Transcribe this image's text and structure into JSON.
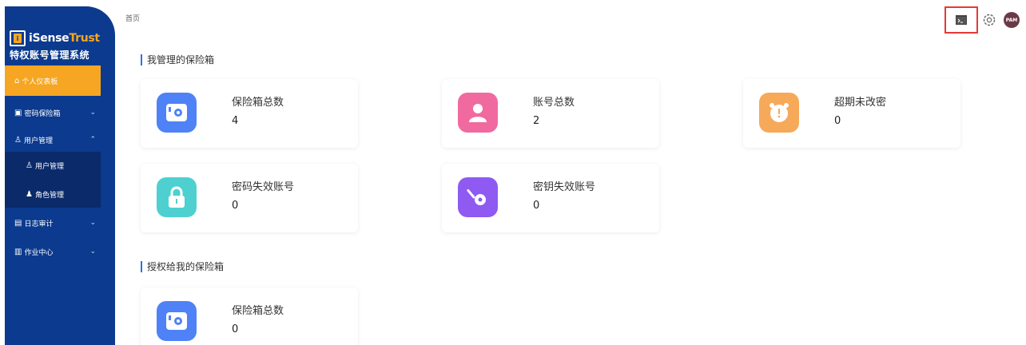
{
  "brand": {
    "logo_prefix": "iSense",
    "logo_suffix": "Trust",
    "system_title": "特权账号管理系统"
  },
  "sidebar": {
    "dashboard_label": "个人仪表板",
    "items": [
      {
        "label": "密码保险箱",
        "icon": "safe-icon",
        "expanded": false
      },
      {
        "label": "用户管理",
        "icon": "user-icon",
        "expanded": true
      },
      {
        "label": "日志审计",
        "icon": "audit-icon",
        "expanded": false
      },
      {
        "label": "作业中心",
        "icon": "job-icon",
        "expanded": false
      }
    ],
    "sub_items": [
      {
        "label": "用户管理",
        "icon": "user-icon"
      },
      {
        "label": "角色管理",
        "icon": "role-icon"
      }
    ]
  },
  "header": {
    "breadcrumb": "首页",
    "avatar_text": "PAM"
  },
  "sections": {
    "mine_title": "我管理的保险箱",
    "granted_title": "授权给我的保险箱"
  },
  "cards": {
    "mine": [
      {
        "label": "保险箱总数",
        "value": "4",
        "icon": "safe-icon",
        "color": "#4f82f7"
      },
      {
        "label": "账号总数",
        "value": "2",
        "icon": "account-icon",
        "color": "#f06aa0"
      },
      {
        "label": "超期未改密",
        "value": "0",
        "icon": "alarm-clock-icon",
        "color": "#f7a95a"
      },
      {
        "label": "密码失效账号",
        "value": "0",
        "icon": "lock-icon",
        "color": "#4fd0d0"
      },
      {
        "label": "密钥失效账号",
        "value": "0",
        "icon": "key-icon",
        "color": "#8e5af2"
      }
    ],
    "granted": [
      {
        "label": "保险箱总数",
        "value": "0",
        "icon": "safe-icon",
        "color": "#4f82f7"
      }
    ]
  },
  "colors": {
    "sidebar_bg": "#0b3a8f",
    "accent": "#f6a623",
    "highlight_box": "#e53935"
  }
}
